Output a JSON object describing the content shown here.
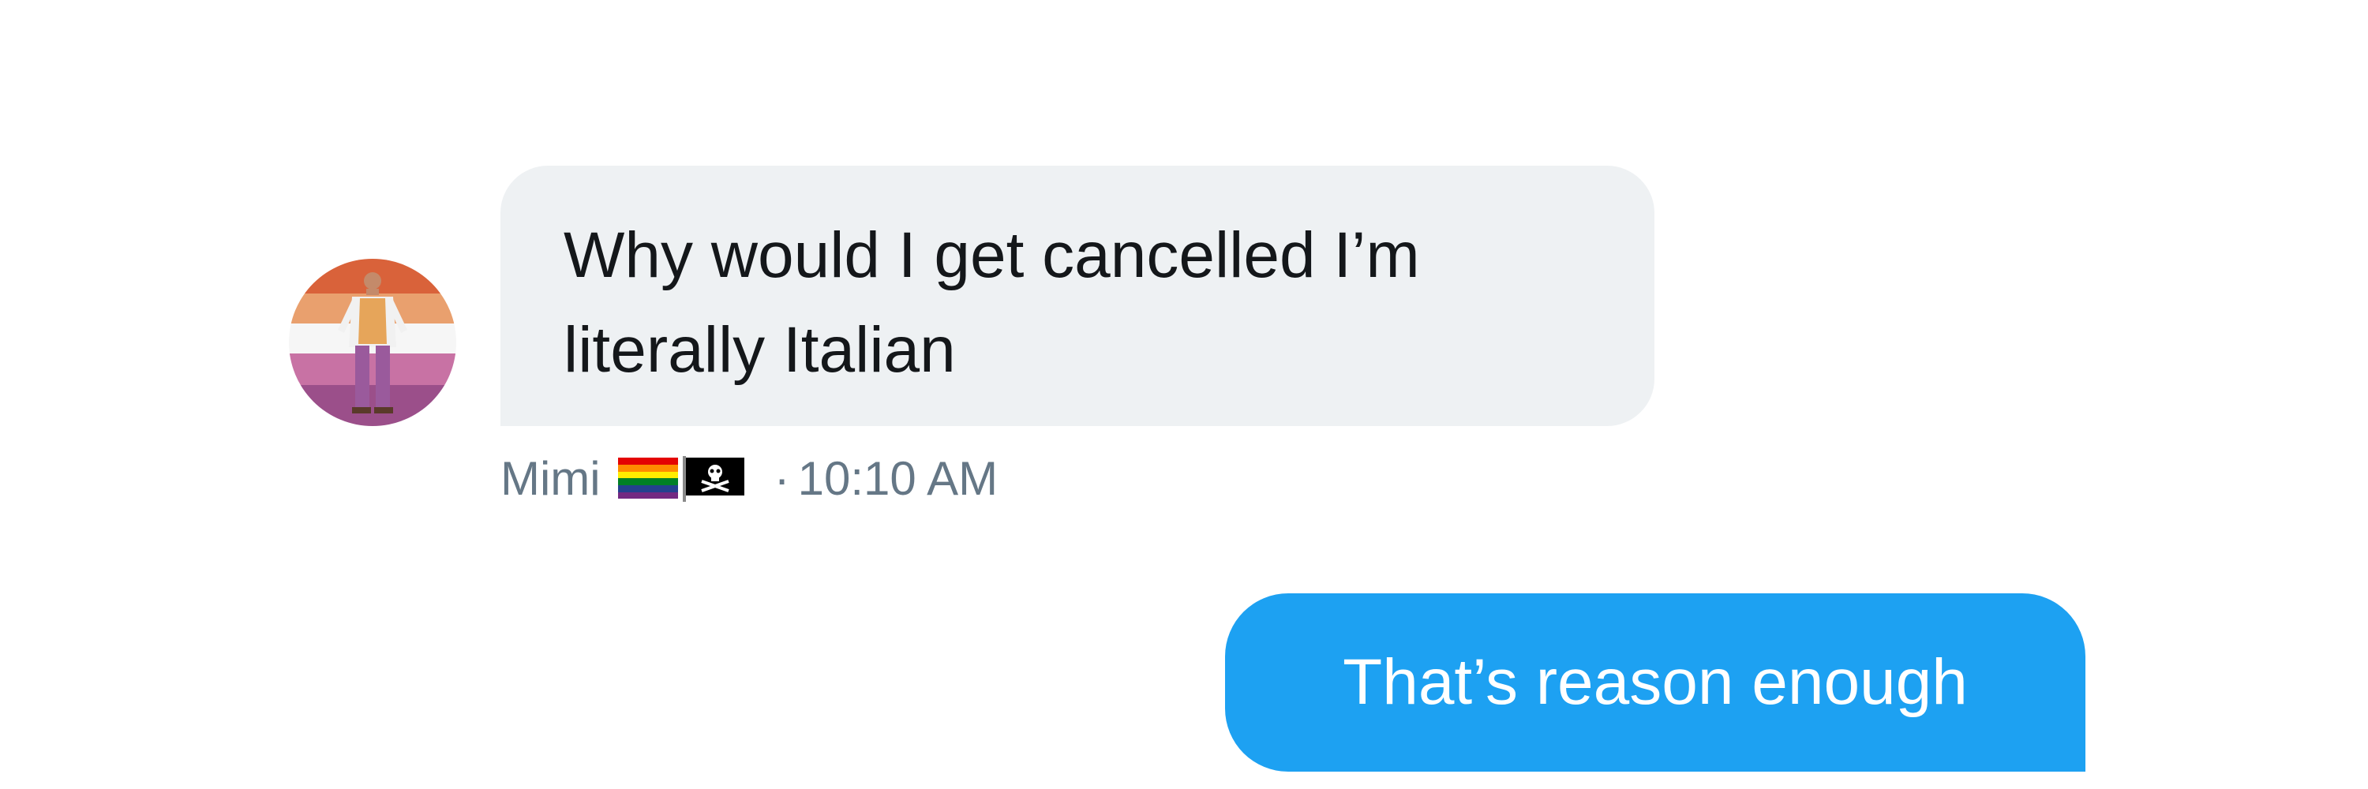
{
  "conversation": {
    "incoming": {
      "sender_name": "Mimi",
      "message_text": "Why would I get cancelled I’m\nliterally Italian",
      "timestamp": "10:10 AM",
      "separator": "·",
      "name_flags": [
        "rainbow-flag-icon",
        "pirate-flag-icon"
      ],
      "avatar_stripe_colors": [
        "#d9623a",
        "#e9a06e",
        "#f6f6f6",
        "#c872a4",
        "#9b4f8a"
      ]
    },
    "outgoing": {
      "message_text": "That’s reason enough"
    }
  },
  "colors": {
    "incoming_bubble": "#eef1f3",
    "outgoing_bubble": "#1da1f2",
    "meta_text": "#657786",
    "message_text": "#14171a"
  }
}
